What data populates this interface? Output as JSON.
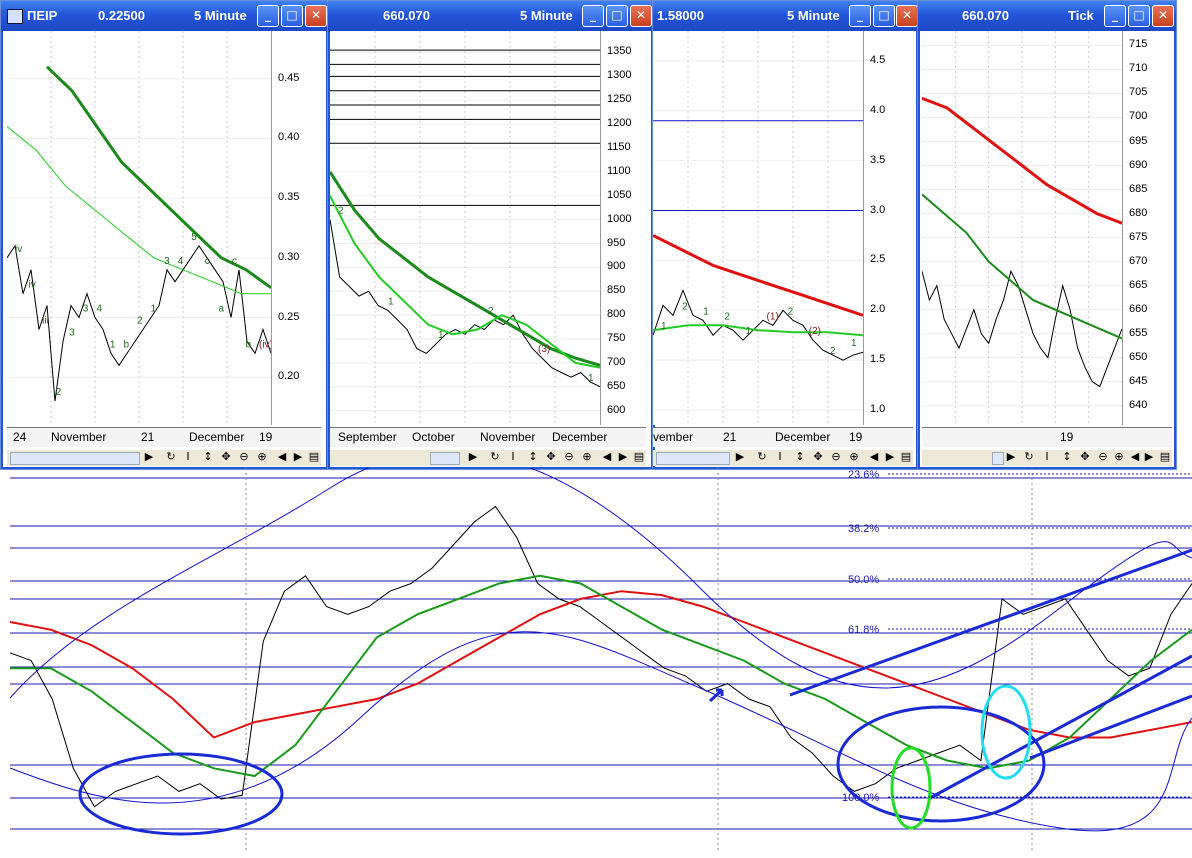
{
  "windows": [
    {
      "id": "w1",
      "symbol": "ΠΕΙΡ",
      "price": "0.22500",
      "interval": "5 Minute",
      "scale_labels": [
        "0.45",
        "0.40",
        "0.35",
        "0.30",
        "0.25",
        "0.20"
      ],
      "scale_values": [
        0.45,
        0.4,
        0.35,
        0.3,
        0.25,
        0.2
      ],
      "ylim": [
        0.16,
        0.49
      ],
      "dates": [
        "24",
        "November",
        "21",
        "December",
        "19"
      ],
      "wave_labels": [
        "iv",
        "iv",
        "iii",
        "2",
        "3",
        "3",
        "4",
        "1",
        "b",
        "2",
        "1",
        "3",
        "4",
        "5",
        "c",
        "a",
        "c",
        "b",
        "(iv)"
      ],
      "icon_color": "#cc2b2b"
    },
    {
      "id": "w2",
      "symbol": "",
      "price": "660.070",
      "interval": "5 Minute",
      "scale_labels": [
        "1350",
        "1300",
        "1250",
        "1200",
        "1150",
        "1100",
        "1050",
        "1000",
        "950",
        "900",
        "850",
        "800",
        "750",
        "700",
        "650",
        "600"
      ],
      "scale_values": [
        1350,
        1300,
        1250,
        1200,
        1150,
        1100,
        1050,
        1000,
        950,
        900,
        850,
        800,
        750,
        700,
        650,
        600
      ],
      "ylim": [
        570,
        1395
      ],
      "dates": [
        "September",
        "October",
        "November",
        "December"
      ],
      "wave_labels": [
        "2",
        "1",
        "1",
        "2",
        "(3)",
        "1"
      ],
      "icon_color": "#1f9a1f"
    },
    {
      "id": "w3",
      "symbol": "",
      "price": "1.58000",
      "interval": "5 Minute",
      "scale_labels": [
        "4.5",
        "4.0",
        "3.5",
        "3.0",
        "2.5",
        "2.0",
        "1.5",
        "1.0"
      ],
      "scale_values": [
        4.5,
        4.0,
        3.5,
        3.0,
        2.5,
        2.0,
        1.5,
        1.0
      ],
      "ylim": [
        0.85,
        4.8
      ],
      "dates": [
        "vember",
        "21",
        "December",
        "19"
      ],
      "wave_labels": [
        "1",
        "2",
        "1",
        "2",
        "1",
        "(1)",
        "2",
        "(2)",
        "2",
        "1"
      ],
      "icon_color": "#1f9a1f"
    },
    {
      "id": "w4",
      "symbol": "",
      "price": "660.070",
      "interval": "Tick",
      "scale_labels": [
        "715",
        "710",
        "705",
        "700",
        "695",
        "690",
        "685",
        "680",
        "675",
        "670",
        "665",
        "660",
        "655",
        "650",
        "645",
        "640"
      ],
      "scale_values": [
        715,
        710,
        705,
        700,
        695,
        690,
        685,
        680,
        675,
        670,
        665,
        660,
        655,
        650,
        645,
        640
      ],
      "ylim": [
        636,
        718
      ],
      "dates": [
        "19"
      ]
    }
  ],
  "main_chart": {
    "fib_labels": [
      "23.6%",
      "38.2%",
      "50.0%",
      "61.8%",
      "100.0%"
    ],
    "accent_colors": {
      "price": "#000000",
      "ma_slow": "#e01010",
      "ma_fast": "#1a9a1a",
      "bands": "#1010cc",
      "channel": "#1a2bd6"
    }
  },
  "chart_data": [
    {
      "type": "line",
      "window": "w1",
      "title": "ΠΕΙΡ 0.22500 5 Minute",
      "ylim": [
        0.16,
        0.49
      ],
      "grid": true,
      "x_labels": [
        "24",
        "November",
        "21",
        "December",
        "19"
      ],
      "series": [
        {
          "values": [
            0.3,
            0.31,
            0.27,
            0.29,
            0.24,
            0.26,
            0.18,
            0.23,
            0.26,
            0.25,
            0.27,
            0.25,
            0.24,
            0.22,
            0.21,
            0.22,
            0.23,
            0.24,
            0.25,
            0.26,
            0.29,
            0.28,
            0.29,
            0.3,
            0.31,
            0.3,
            0.29,
            0.28,
            0.25,
            0.29,
            0.23,
            0.22,
            0.24,
            0.22
          ]
        },
        {
          "values": [
            0.46,
            0.44,
            0.41,
            0.38,
            0.36,
            0.34,
            0.32,
            0.3,
            0.29,
            0.275
          ]
        },
        {
          "values": [
            0.41,
            0.39,
            0.36,
            0.34,
            0.32,
            0.3,
            0.29,
            0.28,
            0.27,
            0.27
          ]
        }
      ]
    },
    {
      "type": "line",
      "window": "w2",
      "title": "660.070 5 Minute",
      "ylim": [
        570,
        1395
      ],
      "grid": true,
      "x_labels": [
        "September",
        "October",
        "November",
        "December"
      ],
      "horizontal_levels": [
        1355,
        1325,
        1300,
        1270,
        1240,
        1210,
        1160,
        1030
      ],
      "series": [
        {
          "values": [
            1000,
            880,
            860,
            840,
            850,
            820,
            810,
            790,
            770,
            730,
            720,
            740,
            760,
            770,
            760,
            780,
            770,
            790,
            780,
            800,
            760,
            730,
            710,
            690,
            680,
            670,
            680,
            660,
            650
          ]
        },
        {
          "values": [
            1100,
            1020,
            960,
            920,
            880,
            850,
            820,
            790,
            760,
            730,
            710,
            695
          ]
        },
        {
          "values": [
            1050,
            950,
            880,
            830,
            780,
            760,
            770,
            800,
            780,
            740,
            700,
            690
          ]
        }
      ]
    },
    {
      "type": "line",
      "window": "w3",
      "title": "1.58000 5 Minute",
      "ylim": [
        0.85,
        4.8
      ],
      "grid": true,
      "x_labels": [
        "vember",
        "21",
        "December",
        "19"
      ],
      "horizontal_levels": [
        3.9,
        3.0
      ],
      "series": [
        {
          "values": [
            1.75,
            2.05,
            1.95,
            2.2,
            1.95,
            1.9,
            1.75,
            1.85,
            1.8,
            1.7,
            1.8,
            1.9,
            1.85,
            2.0,
            1.9,
            1.85,
            1.7,
            1.6,
            1.55,
            1.5,
            1.55,
            1.58
          ]
        },
        {
          "values": [
            2.75,
            2.6,
            2.45,
            2.35,
            2.25,
            2.15,
            2.05,
            1.95
          ]
        },
        {
          "values": [
            1.8,
            1.85,
            1.85,
            1.8,
            1.78,
            1.78,
            1.75
          ]
        }
      ]
    },
    {
      "type": "line",
      "window": "w4",
      "title": "660.070 Tick",
      "ylim": [
        636,
        718
      ],
      "grid": true,
      "x_labels": [
        "19"
      ],
      "series": [
        {
          "values": [
            668,
            662,
            665,
            658,
            655,
            652,
            656,
            660,
            655,
            653,
            658,
            662,
            668,
            665,
            660,
            655,
            652,
            650,
            658,
            665,
            660,
            652,
            648,
            645,
            644,
            648,
            652,
            656
          ]
        },
        {
          "values": [
            704,
            702,
            698,
            694,
            690,
            686,
            683,
            680,
            678
          ]
        },
        {
          "values": [
            684,
            680,
            676,
            670,
            666,
            662,
            660,
            658,
            656,
            654
          ]
        }
      ]
    },
    {
      "type": "line",
      "window": "main",
      "title": "",
      "grid": true,
      "fib_levels": [
        "23.6%",
        "38.2%",
        "50.0%",
        "61.8%",
        "100.0%"
      ],
      "series": [
        {
          "values": [
            0.52,
            0.5,
            0.4,
            0.22,
            0.12,
            0.16,
            0.18,
            0.2,
            0.16,
            0.18,
            0.14,
            0.15,
            0.55,
            0.68,
            0.72,
            0.64,
            0.62,
            0.64,
            0.68,
            0.7,
            0.74,
            0.8,
            0.86,
            0.9,
            0.82,
            0.7,
            0.66,
            0.64,
            0.6,
            0.56,
            0.52,
            0.48,
            0.46,
            0.42,
            0.44,
            0.4,
            0.38,
            0.3,
            0.26,
            0.2,
            0.16,
            0.18,
            0.22,
            0.24,
            0.26,
            0.28,
            0.24,
            0.66,
            0.62,
            0.64,
            0.66,
            0.58,
            0.5,
            0.46,
            0.48,
            0.62,
            0.7
          ]
        },
        {
          "values": [
            0.6,
            0.58,
            0.54,
            0.48,
            0.4,
            0.3,
            0.34,
            0.36,
            0.38,
            0.4,
            0.44,
            0.5,
            0.56,
            0.62,
            0.66,
            0.68,
            0.67,
            0.64,
            0.6,
            0.56,
            0.52,
            0.48,
            0.44,
            0.4,
            0.36,
            0.32,
            0.3,
            0.3,
            0.32,
            0.34
          ]
        },
        {
          "values": [
            0.48,
            0.48,
            0.42,
            0.34,
            0.26,
            0.22,
            0.2,
            0.28,
            0.42,
            0.56,
            0.62,
            0.66,
            0.7,
            0.72,
            0.7,
            0.64,
            0.58,
            0.54,
            0.5,
            0.44,
            0.4,
            0.34,
            0.28,
            0.24,
            0.22,
            0.24,
            0.3,
            0.4,
            0.5,
            0.58
          ]
        }
      ]
    }
  ]
}
